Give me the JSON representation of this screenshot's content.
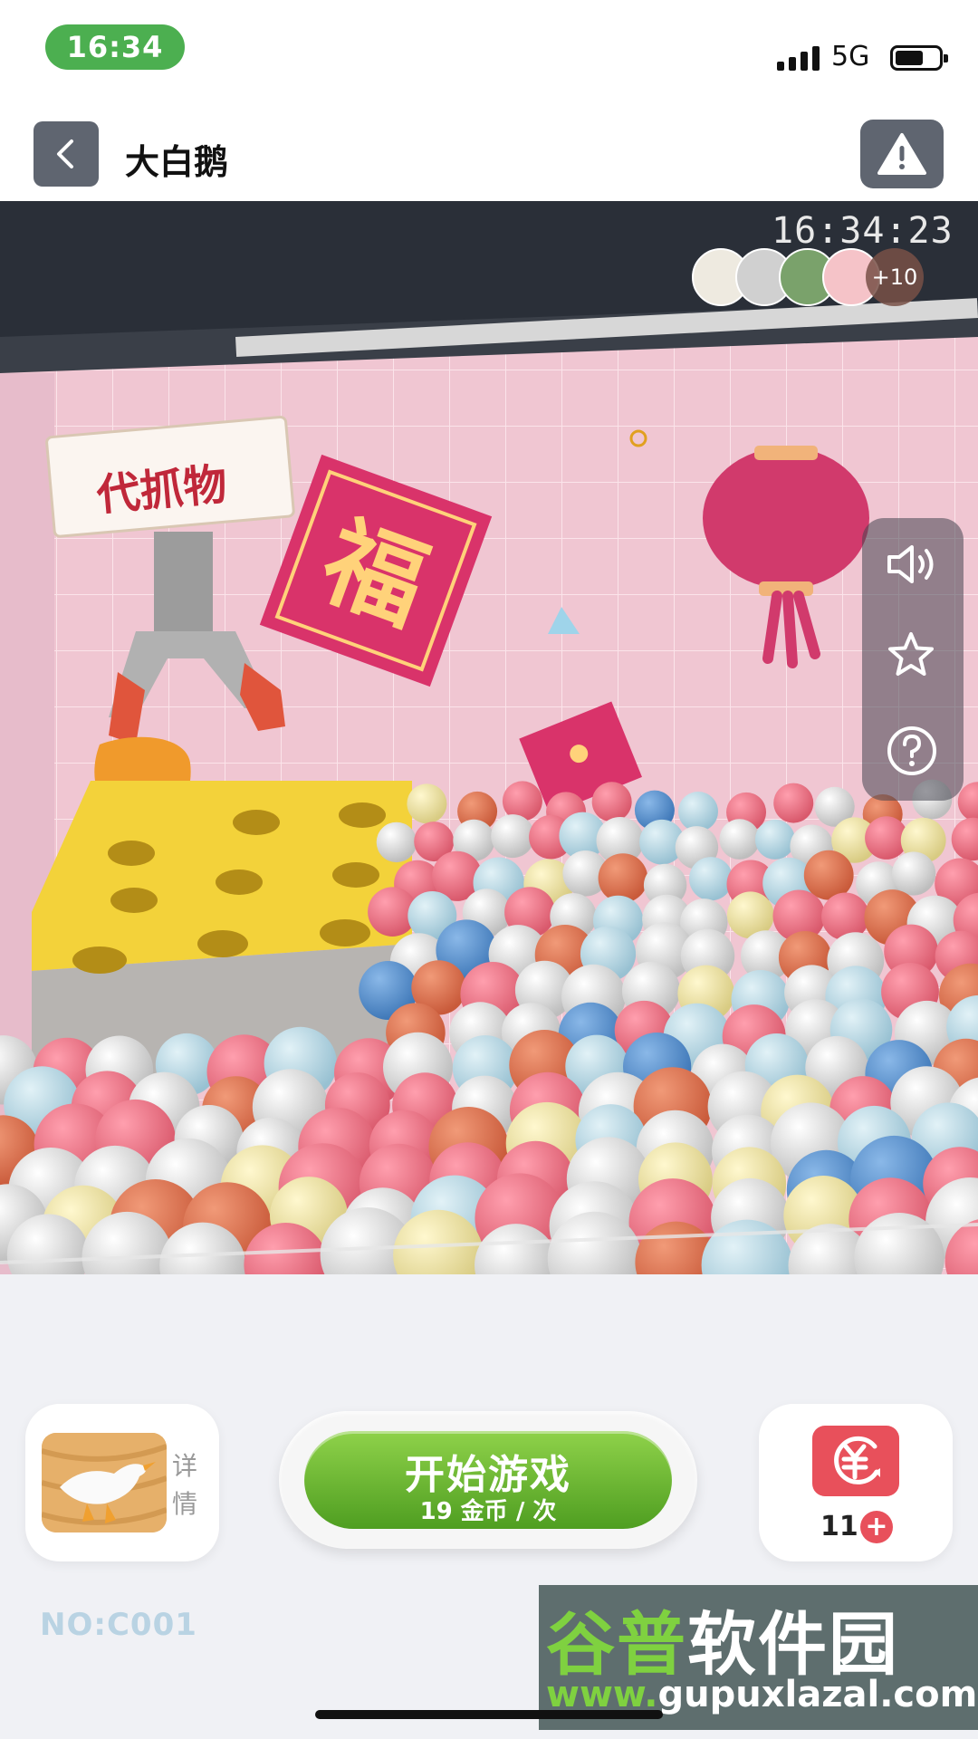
{
  "status_bar": {
    "time": "16:34",
    "network": "5G",
    "battery_level": 0.65
  },
  "header": {
    "title": "大白鹅"
  },
  "stream": {
    "timestamp": "16:34:23",
    "viewers_more": "+10",
    "scene_texts": {
      "sign": "代抓物",
      "fu": "福"
    }
  },
  "side_panel": {
    "icons": [
      "speaker-icon",
      "star-icon",
      "help-icon"
    ]
  },
  "bottom": {
    "detail_label": "详情",
    "start_label": "开始游戏",
    "price_label": "19 金币 / 次",
    "coin_count": "11",
    "coin_plus": "+"
  },
  "machine_no": "NO:C001",
  "watermark": {
    "title_green": "谷普",
    "title_white": "软件园",
    "url_green": "www.",
    "url_white": "gupuxlazal.com"
  },
  "colors": {
    "accent_green": "#4caf50",
    "start_green": "#6bbd32",
    "coin_red": "#e8505b"
  }
}
